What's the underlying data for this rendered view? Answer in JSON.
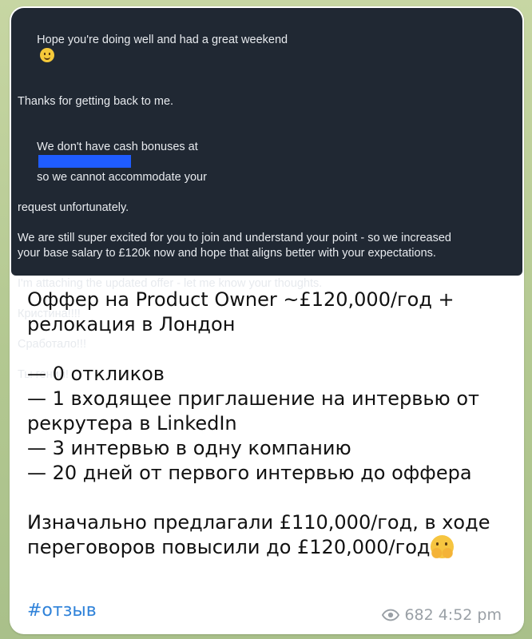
{
  "email": {
    "greeting": "Hope you're doing well and had a great weekend",
    "thanks": "Thanks for getting back to me.",
    "bonus_prefix": "We don't have cash bonuses at",
    "bonus_suffix": "so we cannot accommodate your",
    "bonus_line2": "request unfortunately.",
    "excited_line1": "We are still super excited for you to join and understand your point - so we increased",
    "excited_line2": "your base salary to £120k now and hope that aligns better with your expectations.",
    "attaching": "I'm attaching the updated offer - let me know your thoughts.",
    "reply1": "Кристина!!!!",
    "reply2": "Сработало!!!",
    "reply3": "Ты гений!",
    "colors": {
      "background": "#202833",
      "redaction": "#1f5cff"
    }
  },
  "message": {
    "line1": "Оффер на Product Owner ~£120,000/год +",
    "line2": "релокация в Лондон",
    "bullet1": "— 0 откликов",
    "bullet2_line1": "— 1 входящее приглашение на интервью от",
    "bullet2_line2": "рекрутера в LinkedIn",
    "bullet3": "— 3 интервью в одну компанию",
    "bullet4": "— 20 дней от первого интервью до оффера",
    "summary_line1": "Изначально предлагали £110,000/год, в ходе",
    "summary_line2": "переговоров повысили до £120,000/год",
    "hashtag": "#отзыв",
    "views": "682",
    "time": "4:52 pm",
    "colors": {
      "hashtag": "#2f82d9",
      "meta": "#9aa0a6",
      "chat_background": "#b9cc9a"
    },
    "icons": {
      "views": "eye-icon",
      "smile": "slightly-smiling-face-icon",
      "hug": "hugging-face-icon"
    }
  }
}
